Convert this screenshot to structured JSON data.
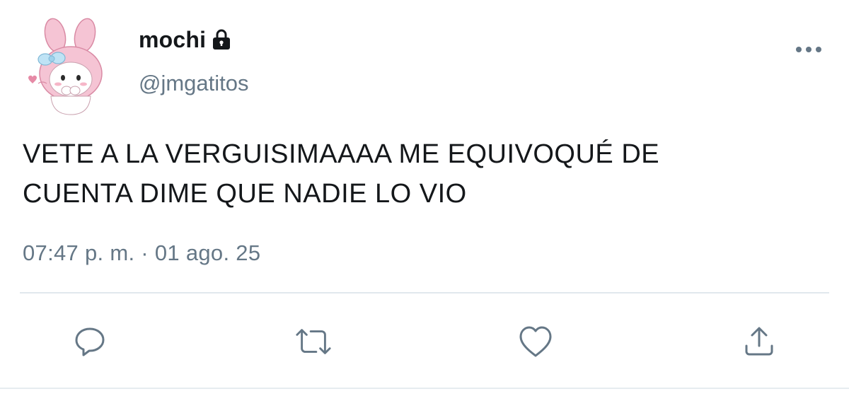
{
  "user": {
    "display_name": "mochi",
    "handle": "@jmgatitos",
    "protected_icon": "lock-icon",
    "avatar_icon": "bunny-hood-character-avatar"
  },
  "tweet": {
    "text": "VETE A LA VERGUISIMAAAA ME EQUIVOQUÉ DE\nCUENTA DIME QUE NADIE LO VIO",
    "timestamp": "07:47 p. m. · 01 ago. 25"
  },
  "actions": [
    {
      "name": "reply",
      "icon": "speech-bubble-icon"
    },
    {
      "name": "retweet",
      "icon": "retweet-arrows-icon"
    },
    {
      "name": "like",
      "icon": "heart-icon"
    },
    {
      "name": "share",
      "icon": "share-upload-icon"
    }
  ],
  "menu": {
    "icon": "more-dots-icon"
  },
  "colors": {
    "text_primary": "#14171a",
    "text_secondary": "#657786",
    "icon": "#657786",
    "divider": "#e1e8ed",
    "avatar_pink": "#f5c4d4"
  }
}
